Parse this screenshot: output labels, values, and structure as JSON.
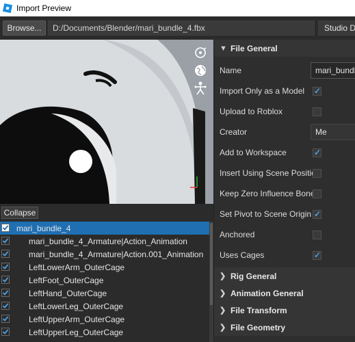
{
  "window": {
    "title": "Import Preview"
  },
  "toolbar": {
    "browse_label": "Browse...",
    "file_path": "D:/Documents/Blender/mari_bundle_4.fbx",
    "studio_button": "Studio De"
  },
  "tree": {
    "collapse_label": "Collapse",
    "items": [
      {
        "label": "mari_bundle_4",
        "checked": true,
        "selected": true
      },
      {
        "label": "mari_bundle_4_Armature|Action_Animation",
        "checked": true
      },
      {
        "label": "mari_bundle_4_Armature|Action.001_Animation",
        "checked": true
      },
      {
        "label": "LeftLowerArm_OuterCage",
        "checked": true
      },
      {
        "label": "LeftFoot_OuterCage",
        "checked": true
      },
      {
        "label": "LeftHand_OuterCage",
        "checked": true
      },
      {
        "label": "LeftLowerLeg_OuterCage",
        "checked": true
      },
      {
        "label": "LeftUpperArm_OuterCage",
        "checked": true
      },
      {
        "label": "LeftUpperLeg_OuterCage",
        "checked": true
      }
    ]
  },
  "props": {
    "file_general": {
      "title": "File General",
      "name_label": "Name",
      "name_value": "mari_bundl",
      "import_model_label": "Import Only as a Model",
      "upload_label": "Upload to Roblox",
      "creator_label": "Creator",
      "creator_value": "Me",
      "add_workspace_label": "Add to Workspace",
      "insert_scene_label": "Insert Using Scene Position",
      "keep_zero_label": "Keep Zero Influence Bones",
      "set_pivot_label": "Set Pivot to Scene Origin",
      "anchored_label": "Anchored",
      "uses_cages_label": "Uses Cages"
    },
    "sections": [
      {
        "title": "Rig General"
      },
      {
        "title": "Animation General"
      },
      {
        "title": "File Transform"
      },
      {
        "title": "File Geometry"
      }
    ]
  },
  "colors": {
    "accent": "#1f6fb2",
    "check": "#4aa0e6"
  }
}
